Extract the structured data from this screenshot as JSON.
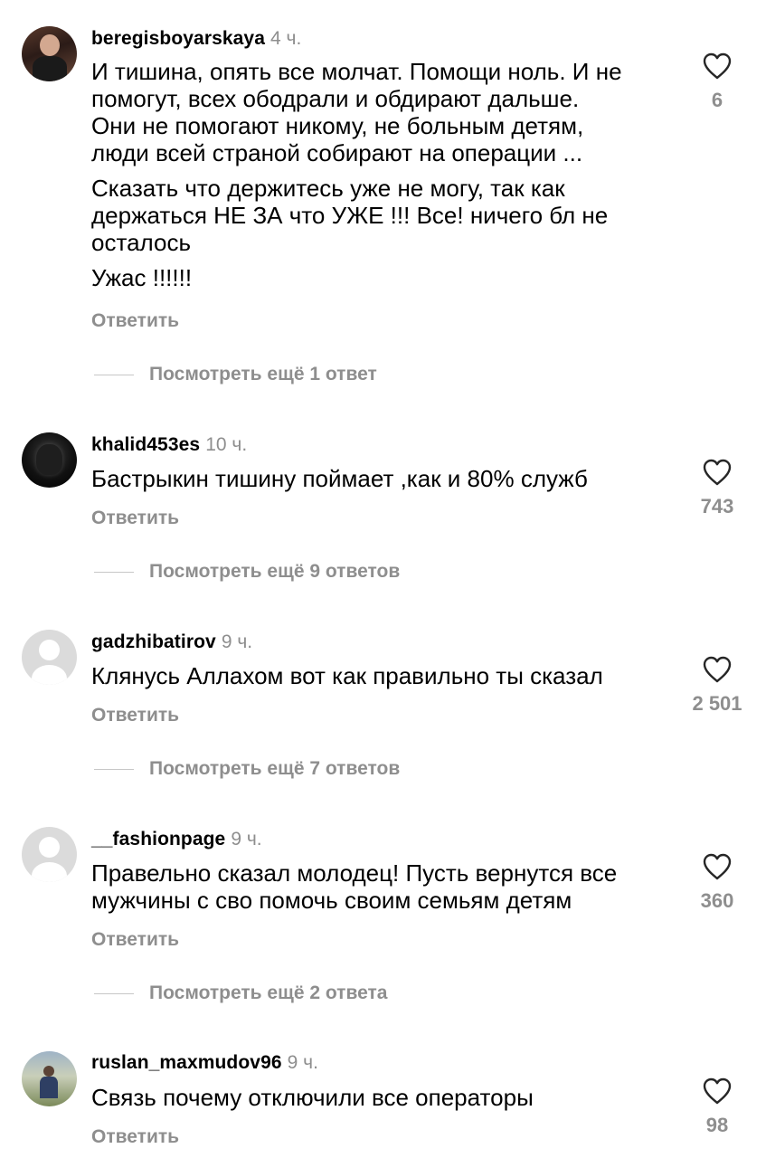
{
  "comments": [
    {
      "username": "beregisboyarskaya",
      "time": "4 ч.",
      "paragraphs": [
        [
          "И тишина, опять все молчат. Помощи ноль. И не",
          "помогут, всех ободрали и обдирают дальше.",
          "Они не помогают никому, не больным детям,",
          "люди всей страной собирают на операции ..."
        ],
        [
          "Сказать что держитесь уже не могу, так как",
          "держаться НЕ ЗА что УЖЕ !!! Все! ничего бл не",
          "осталось"
        ],
        [
          "Ужас !!!!!!"
        ]
      ],
      "likes": "6",
      "reply_label": "Ответить",
      "more_replies": "Посмотреть ещё 1 ответ"
    },
    {
      "username": "khalid453es",
      "time": "10 ч.",
      "paragraphs": [
        [
          "Бастрыкин тишину поймает ,как и 80% служб"
        ]
      ],
      "likes": "743",
      "reply_label": "Ответить",
      "more_replies": "Посмотреть ещё 9 ответов"
    },
    {
      "username": "gadzhibatirov",
      "time": "9 ч.",
      "paragraphs": [
        [
          "Клянусь Аллахом вот как правильно ты сказал"
        ]
      ],
      "likes": "2 501",
      "reply_label": "Ответить",
      "more_replies": "Посмотреть ещё 7 ответов"
    },
    {
      "username": "__fashionpage",
      "time": "9 ч.",
      "paragraphs": [
        [
          "Правельно сказал молодец! Пусть вернутся все",
          "мужчины с сво помочь своим семьям детям"
        ]
      ],
      "likes": "360",
      "reply_label": "Ответить",
      "more_replies": "Посмотреть ещё 2 ответа"
    },
    {
      "username": "ruslan_maxmudov96",
      "time": "9 ч.",
      "paragraphs": [
        [
          "Связь почему отключили все операторы"
        ]
      ],
      "likes": "98",
      "reply_label": "Ответить"
    }
  ],
  "icons": {
    "like": "heart-outline-icon",
    "avatar_default": "default-user-icon"
  },
  "colors": {
    "secondary_text": "#8e8e8e",
    "divider": "#c7c7c7"
  }
}
